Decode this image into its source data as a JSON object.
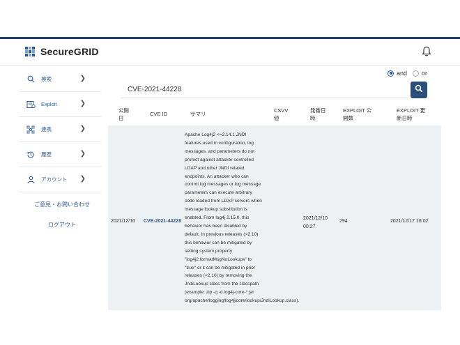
{
  "header": {
    "app_name": "SecureGRID"
  },
  "sidebar": {
    "items": [
      {
        "label": "検索",
        "icon": "search-icon"
      },
      {
        "label": "Exploit",
        "icon": "exploit-icon"
      },
      {
        "label": "連携",
        "icon": "integration-icon"
      },
      {
        "label": "履歴",
        "icon": "history-icon"
      },
      {
        "label": "アカウント",
        "icon": "user-icon"
      }
    ],
    "contact": "ご意見・お問い合わせ",
    "logout": "ログアウト"
  },
  "search": {
    "value": "CVE-2021-44228",
    "option_and": "and",
    "option_or": "or",
    "selected": "and"
  },
  "table": {
    "headers": {
      "published": "公開\n日",
      "cve_id": "CVE ID",
      "summary": "サマリ",
      "cvss": "CSVV\n値",
      "disclosed": "発番日\n時",
      "exploit_count": "EXPLOIT 公\n開数",
      "exploit_updated": "EXPLOIT 更\n新日時"
    },
    "rows": [
      {
        "published": "2021/12/10",
        "cve_id": "CVE-2021-44228",
        "summary": "Apache Log4j2 <=2.14.1 JNDI features used in configuration, log messages, and parameters do not protect against attacker controlled LDAP and other JNDI related endpoints. An attacker who can control log messages or log message parameters can execute arbitrary code loaded from LDAP servers when message lookup substitution is enabled. From log4j 2.15.0, this behavior has been disabled by default. In previous releases (>2.10) this behavior can be mitigated by setting system property \"log4j2.formatMsgNoLookups\" to \"true\" or it can be mitigated in prior releases (<2.10) by removing the JndiLookup class from the classpath (example: zip -q -d log4j-core-*.jar org/apache/logging/log4j/core/lookup/JndiLookup.class).",
        "cvss": "",
        "disclosed": "2021/12/10\n00:27",
        "exploit_count": "294",
        "exploit_updated": "2021/12/17 16:02"
      }
    ]
  },
  "colors": {
    "brand": "#1f3f68",
    "link": "#2a5a9a",
    "row_bg": "#eef1f3"
  }
}
